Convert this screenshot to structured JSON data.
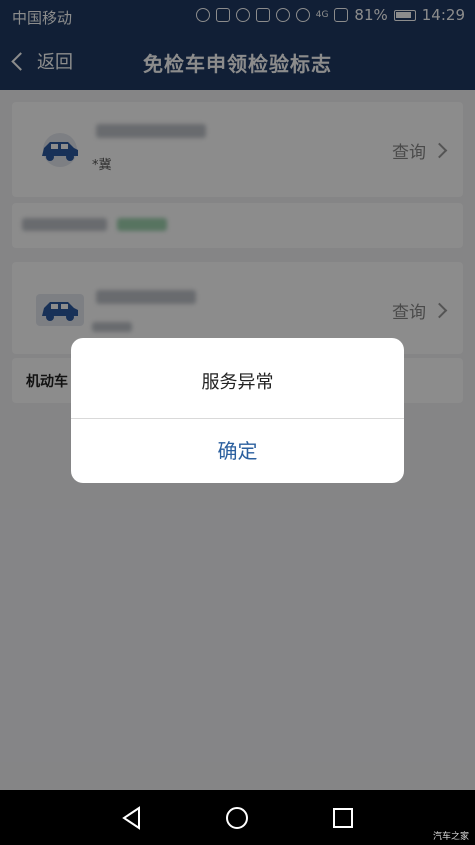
{
  "status_bar": {
    "carrier": "中国移动",
    "battery": "81%",
    "time": "14:29",
    "network": "4G"
  },
  "nav": {
    "back_label": "返回",
    "title": "免检车申领检验标志"
  },
  "vehicles": [
    {
      "plate_prefix": "*冀",
      "query_label": "查询"
    },
    {
      "query_label": "查询"
    }
  ],
  "card2_footer_label": "机动车",
  "dialog": {
    "message": "服务异常",
    "confirm_label": "确定"
  },
  "watermark": "汽车之家",
  "colors": {
    "nav_bg": "#1f3a63",
    "accent": "#2b5f9e",
    "car_icon": "#2c5aa0"
  }
}
